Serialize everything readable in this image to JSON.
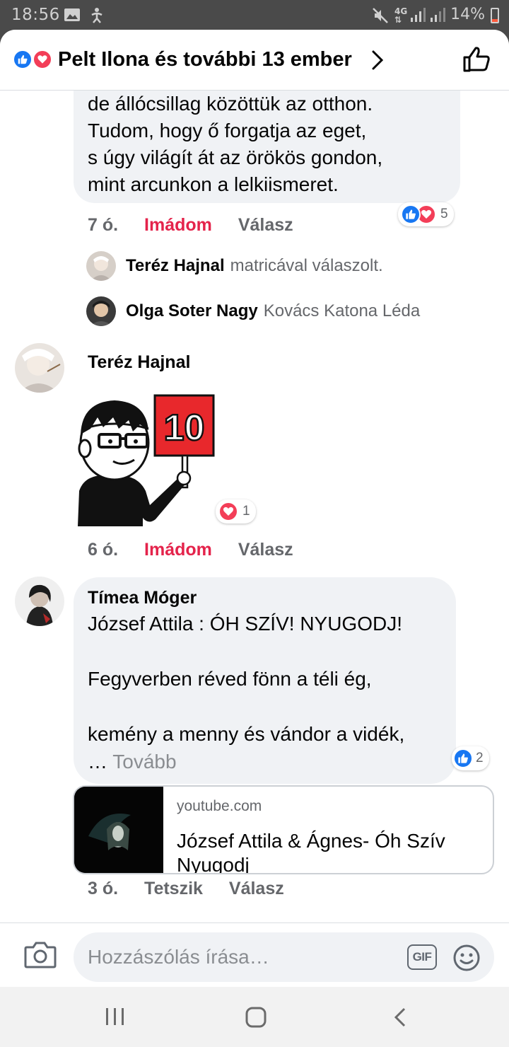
{
  "status_bar": {
    "time": "18:56",
    "battery": "14%",
    "icons": [
      "gallery-icon",
      "accessibility-icon",
      "mute-icon",
      "lte-icon",
      "signal-icon",
      "signal-icon",
      "battery-icon"
    ]
  },
  "header": {
    "title": "Pelt Ilona és további 13 ember",
    "reactions": [
      "like-icon",
      "love-icon"
    ]
  },
  "colors": {
    "like": "#1877f2",
    "love": "#f33e58",
    "love_text": "#e4234b",
    "bubble": "#f0f2f5",
    "meta": "#65676b"
  },
  "comment1": {
    "text_lines": [
      "de állócsillag közöttük az otthon.",
      "Tudom, hogy ő forgatja az eget,",
      "s úgy világít át az örökös gondon,",
      "mint arcunkon a lelkiismeret."
    ],
    "time": "7 ó.",
    "reaction_label": "Imádom",
    "reply_label": "Válasz",
    "reaction_count": "5",
    "replies": [
      {
        "name": "Teréz Hajnal",
        "text": "matricával válaszolt."
      },
      {
        "name": "Olga Soter Nagy",
        "text": "Kovács Katona Léda"
      }
    ]
  },
  "comment2": {
    "author": "Teréz Hajnal",
    "sticker_number": "10",
    "time": "6 ó.",
    "reaction_label": "Imádom",
    "reply_label": "Válasz",
    "reaction_count": "1"
  },
  "comment3": {
    "author": "Tímea Móger",
    "text": "József Attila : ÓH SZÍV! NYUGODJ!\n\nFegyverben réved fönn a téli ég,\n\nkemény a menny és vándor a vidék,\n… ",
    "more_label": "Tovább",
    "reaction_count": "2",
    "link": {
      "domain": "youtube.com",
      "title": "József Attila & Ágnes- Óh Szív Nyugodj"
    },
    "time": "3 ó.",
    "reaction_label": "Tetszik",
    "reply_label": "Válasz"
  },
  "composer": {
    "placeholder": "Hozzászólás írása…",
    "gif_label": "GIF"
  }
}
